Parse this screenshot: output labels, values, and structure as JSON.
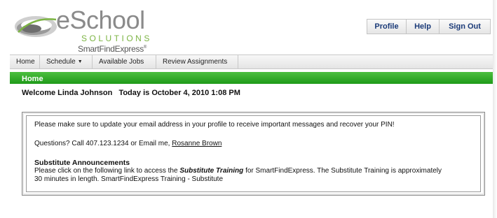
{
  "logo": {
    "brand_main": "eSchool",
    "brand_sub": "SOLUTIONS",
    "product": "SmartFindExpress",
    "trademark": "®"
  },
  "topnav": {
    "profile": "Profile",
    "help": "Help",
    "signout": "Sign Out"
  },
  "menu": {
    "home": "Home",
    "schedule": "Schedule",
    "available_jobs": "Available Jobs",
    "review_assignments": "Review Assignments"
  },
  "section_title": "Home",
  "welcome": {
    "greeting": "Welcome Linda Johnson",
    "date_prefix": "Today is",
    "date": "October 4, 2010 1:08 PM"
  },
  "messages": {
    "email_notice": "Please make sure to update your email address in your profile to receive important messages and recover your PIN!",
    "questions_prefix": "Questions? Call 407.123.1234 or Email me,",
    "contact_name": "Rosanne Brown",
    "announcements_title": "Substitute Announcements",
    "training_prefix": "Please click on the following link to access the",
    "training_emph": "Substitute Training",
    "training_suffix": "for SmartFindExpress. The Substitute Training is approximately",
    "training_line2": "30 minutes in length. SmartFindExpress Training - Substitute"
  },
  "colors": {
    "green_bar": "#2aa823",
    "nav_text": "#1a3a78",
    "logo_green": "#7cb443"
  }
}
